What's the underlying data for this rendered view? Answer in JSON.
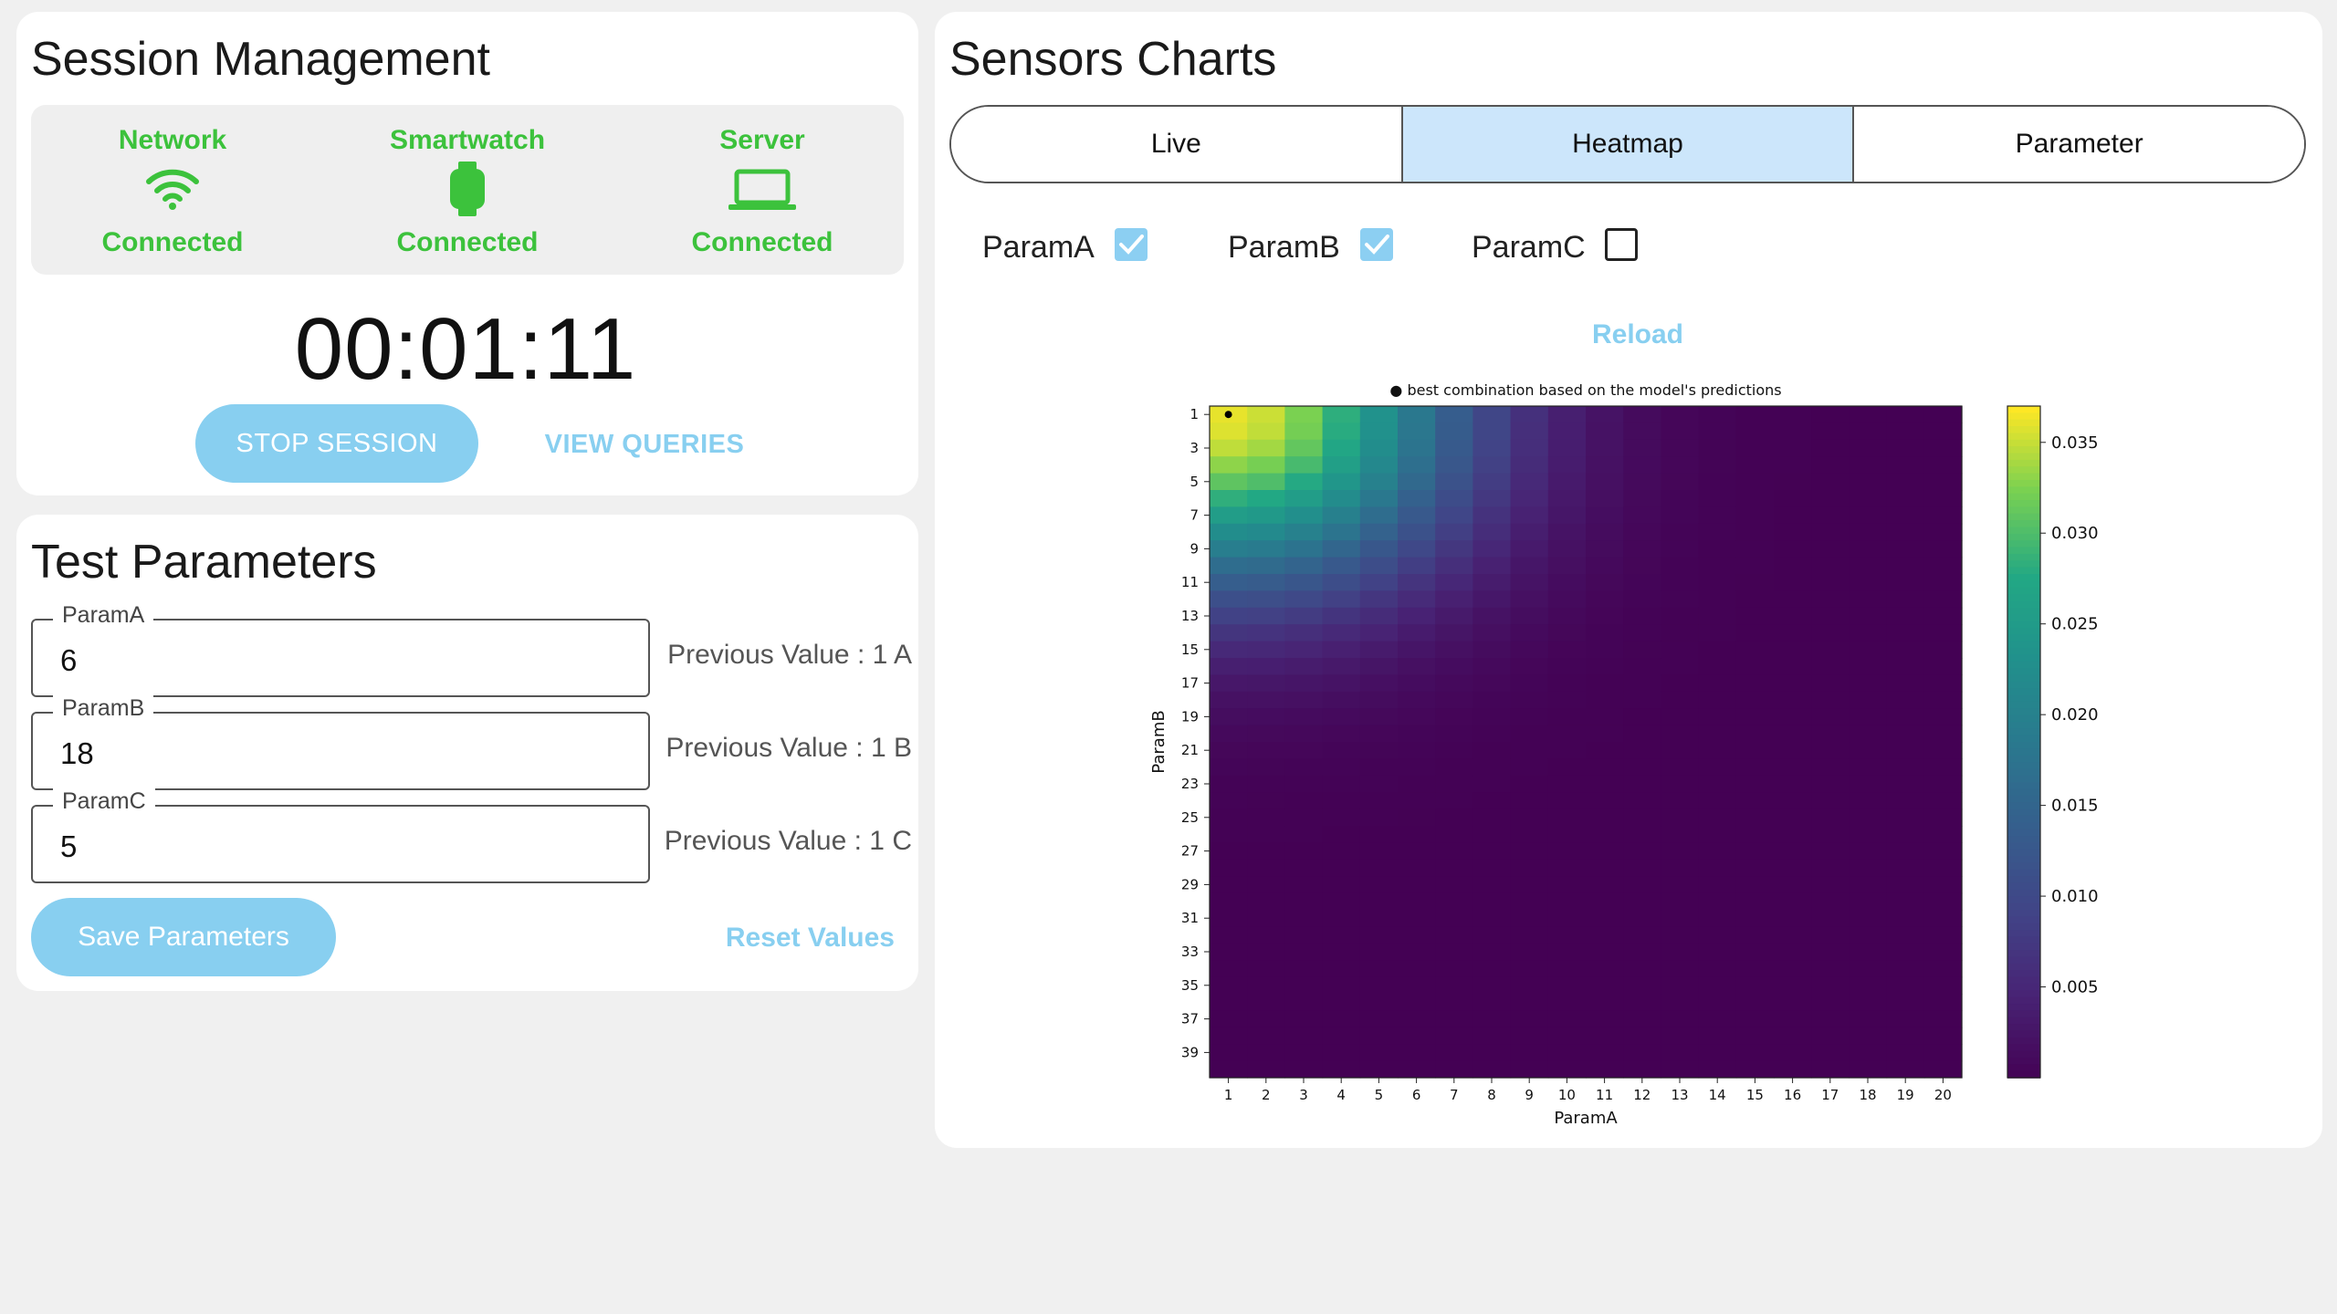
{
  "session": {
    "title": "Session Management",
    "status": [
      {
        "name": "Network",
        "state": "Connected",
        "icon": "wifi-icon"
      },
      {
        "name": "Smartwatch",
        "state": "Connected",
        "icon": "smartwatch-icon"
      },
      {
        "name": "Server",
        "state": "Connected",
        "icon": "laptop-icon"
      }
    ],
    "timer": "00:01:11",
    "stop_label": "STOP SESSION",
    "view_queries_label": "VIEW QUERIES"
  },
  "test_params": {
    "title": "Test Parameters",
    "fields": [
      {
        "label": "ParamA",
        "value": "6",
        "previous": "Previous Value : 1  A"
      },
      {
        "label": "ParamB",
        "value": "18",
        "previous": "Previous Value : 1  B"
      },
      {
        "label": "ParamC",
        "value": "5",
        "previous": "Previous Value : 1  C"
      }
    ],
    "save_label": "Save Parameters",
    "reset_label": "Reset Values"
  },
  "charts": {
    "title": "Sensors Charts",
    "tabs": [
      {
        "label": "Live",
        "active": false
      },
      {
        "label": "Heatmap",
        "active": true
      },
      {
        "label": "Parameter",
        "active": false
      }
    ],
    "checks": [
      {
        "label": "ParamA",
        "checked": true
      },
      {
        "label": "ParamB",
        "checked": true
      },
      {
        "label": "ParamC",
        "checked": false
      }
    ],
    "reload_label": "Reload"
  },
  "colors": {
    "status_green": "#3cc23c",
    "accent_blue": "#88cff0",
    "active_tab": "#cce6fb"
  },
  "chart_data": {
    "type": "heatmap",
    "title": "● best combination based on the model's predictions",
    "xlabel": "ParamA",
    "ylabel": "ParamB",
    "x_ticks": [
      "1",
      "2",
      "3",
      "4",
      "5",
      "6",
      "7",
      "8",
      "9",
      "10",
      "11",
      "12",
      "13",
      "14",
      "15",
      "16",
      "17",
      "18",
      "19",
      "20"
    ],
    "y_ticks": [
      "1",
      "3",
      "5",
      "7",
      "9",
      "11",
      "13",
      "15",
      "17",
      "19",
      "21",
      "23",
      "25",
      "27",
      "29",
      "31",
      "33",
      "35",
      "37",
      "39"
    ],
    "x_range": [
      1,
      20
    ],
    "y_range": [
      1,
      40
    ],
    "value_range": [
      0,
      0.037
    ],
    "colormap": "viridis",
    "colorbar_ticks": [
      "0.005",
      "0.010",
      "0.015",
      "0.020",
      "0.025",
      "0.030",
      "0.035"
    ],
    "best_point": {
      "x": 1,
      "y": 1
    },
    "sample_values": [
      {
        "x": 1,
        "y": 1,
        "value": 0.036
      },
      {
        "x": 4,
        "y": 1,
        "value": 0.03
      },
      {
        "x": 7,
        "y": 1,
        "value": 0.02
      },
      {
        "x": 1,
        "y": 7,
        "value": 0.02
      },
      {
        "x": 1,
        "y": 12,
        "value": 0.008
      },
      {
        "x": 12,
        "y": 1,
        "value": 0.008
      },
      {
        "x": 20,
        "y": 40,
        "value": 0.0
      }
    ]
  }
}
